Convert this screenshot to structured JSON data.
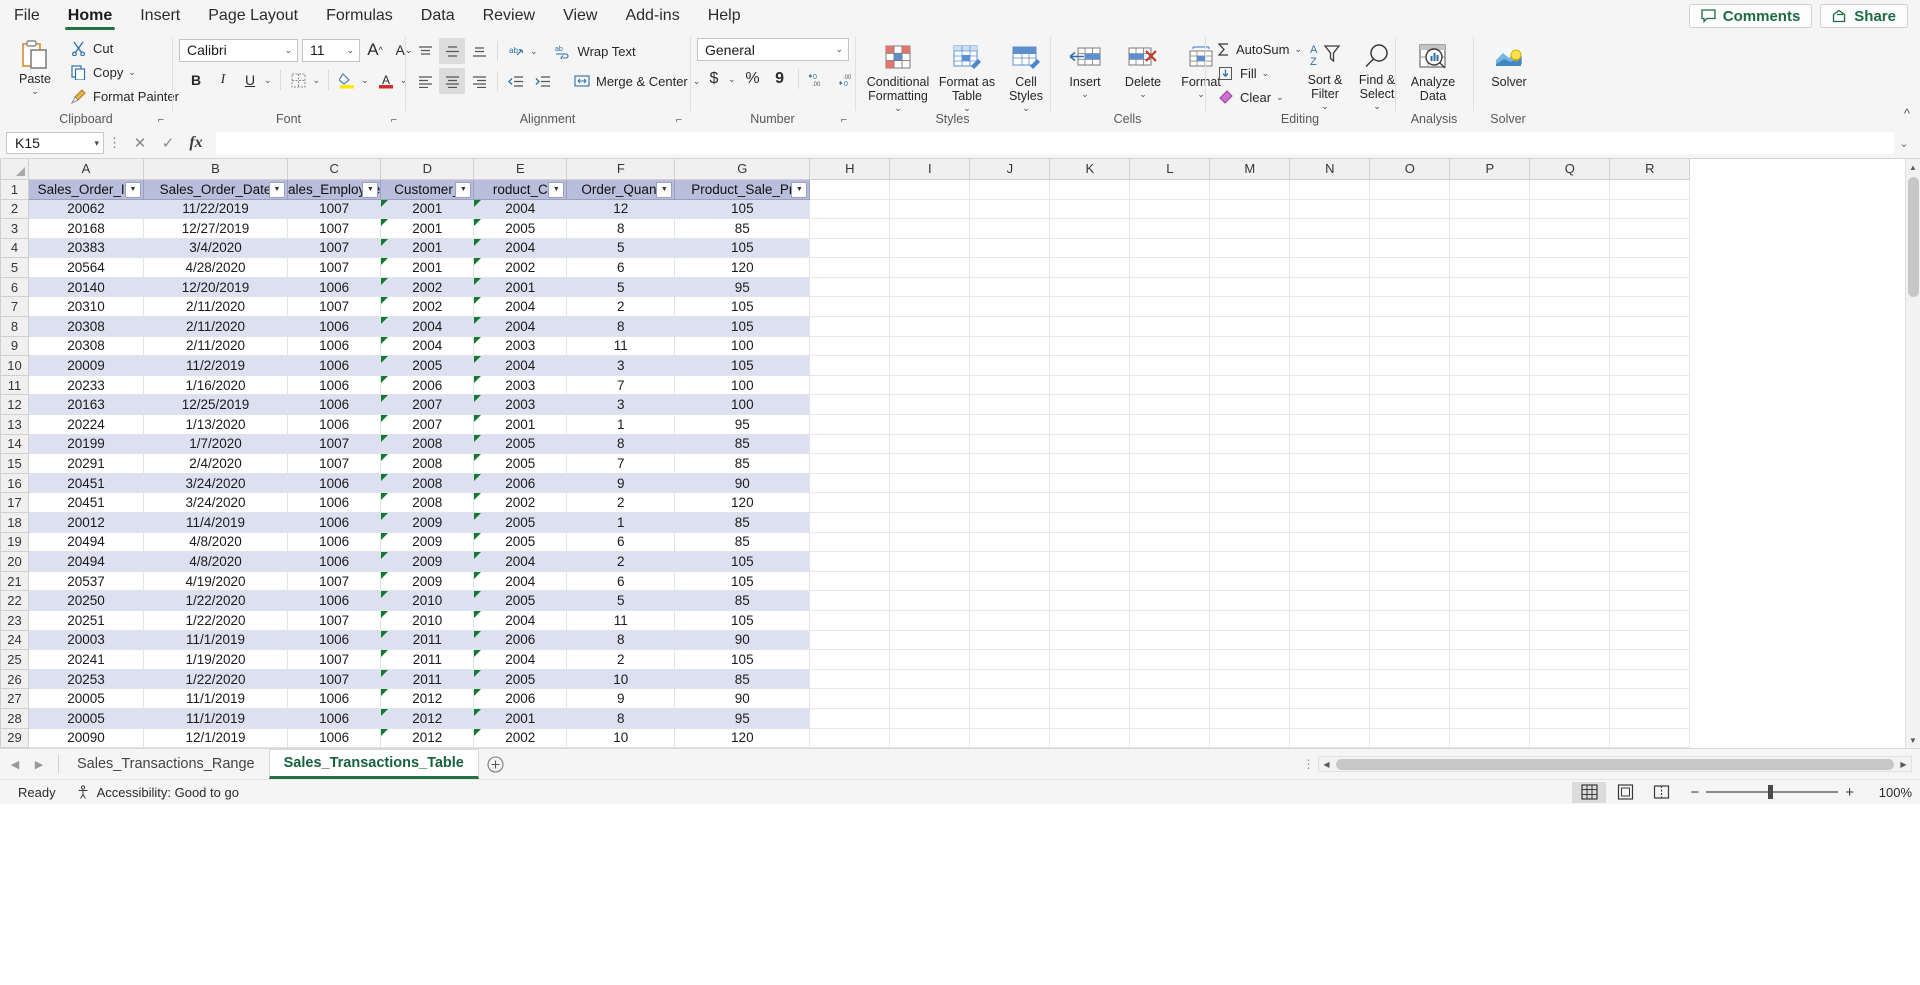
{
  "window": {
    "comments_label": "Comments",
    "share_label": "Share"
  },
  "ribbon": {
    "tabs": [
      {
        "label": "File",
        "active": false
      },
      {
        "label": "Home",
        "active": true
      },
      {
        "label": "Insert",
        "active": false
      },
      {
        "label": "Page Layout",
        "active": false
      },
      {
        "label": "Formulas",
        "active": false
      },
      {
        "label": "Data",
        "active": false
      },
      {
        "label": "Review",
        "active": false
      },
      {
        "label": "View",
        "active": false
      },
      {
        "label": "Add-ins",
        "active": false
      },
      {
        "label": "Help",
        "active": false
      }
    ],
    "groups": {
      "clipboard": {
        "label": "Clipboard",
        "paste": "Paste",
        "cut": "Cut",
        "copy": "Copy",
        "format_painter": "Format Painter"
      },
      "font": {
        "label": "Font",
        "font_name": "Calibri",
        "font_size": "11",
        "grow_font": "A",
        "shrink_font": "A",
        "bold": "B",
        "italic": "I",
        "underline": "U"
      },
      "alignment": {
        "label": "Alignment",
        "wrap_text": "Wrap Text",
        "merge_center": "Merge & Center"
      },
      "number": {
        "label": "Number",
        "format": "General",
        "currency": "$",
        "percent": "%",
        "comma": "9"
      },
      "styles": {
        "label": "Styles",
        "conditional_formatting": "Conditional Formatting",
        "format_as_table": "Format as Table",
        "cell_styles": "Cell Styles"
      },
      "cells": {
        "label": "Cells",
        "insert": "Insert",
        "delete": "Delete",
        "format": "Format"
      },
      "editing": {
        "label": "Editing",
        "autosum": "AutoSum",
        "fill": "Fill",
        "clear": "Clear",
        "sort_filter": "Sort & Filter",
        "find_select": "Find & Select"
      },
      "analysis": {
        "label": "Analysis",
        "analyze_data": "Analyze Data"
      },
      "solver": {
        "label": "Solver",
        "solver": "Solver"
      }
    }
  },
  "formula_bar": {
    "name_box": "K15",
    "formula": "",
    "cancel_icon": "x-icon",
    "confirm_icon": "check-icon",
    "function_icon": "fx"
  },
  "grid": {
    "column_letters": [
      "A",
      "B",
      "C",
      "D",
      "E",
      "F",
      "G",
      "H",
      "I",
      "J",
      "K",
      "L",
      "M",
      "N",
      "O",
      "P",
      "Q",
      "R"
    ],
    "table_headers": [
      "Sales_Order_ID",
      "Sales_Order_Date",
      "ales_Employee",
      "Customer_",
      "roduct_C",
      "Order_Quant",
      "Product_Sale_Pr"
    ],
    "rows": [
      {
        "num": "1",
        "type": "header"
      },
      {
        "num": "2",
        "cells": [
          "20062",
          "11/22/2019",
          "1007",
          "2001",
          "2004",
          "12",
          "105"
        ]
      },
      {
        "num": "3",
        "cells": [
          "20168",
          "12/27/2019",
          "1007",
          "2001",
          "2005",
          "8",
          "85"
        ]
      },
      {
        "num": "4",
        "cells": [
          "20383",
          "3/4/2020",
          "1007",
          "2001",
          "2004",
          "5",
          "105"
        ]
      },
      {
        "num": "5",
        "cells": [
          "20564",
          "4/28/2020",
          "1007",
          "2001",
          "2002",
          "6",
          "120"
        ]
      },
      {
        "num": "6",
        "cells": [
          "20140",
          "12/20/2019",
          "1006",
          "2002",
          "2001",
          "5",
          "95"
        ]
      },
      {
        "num": "7",
        "cells": [
          "20310",
          "2/11/2020",
          "1007",
          "2002",
          "2004",
          "2",
          "105"
        ]
      },
      {
        "num": "8",
        "cells": [
          "20308",
          "2/11/2020",
          "1006",
          "2004",
          "2004",
          "8",
          "105"
        ]
      },
      {
        "num": "9",
        "cells": [
          "20308",
          "2/11/2020",
          "1006",
          "2004",
          "2003",
          "11",
          "100"
        ]
      },
      {
        "num": "10",
        "cells": [
          "20009",
          "11/2/2019",
          "1006",
          "2005",
          "2004",
          "3",
          "105"
        ]
      },
      {
        "num": "11",
        "cells": [
          "20233",
          "1/16/2020",
          "1006",
          "2006",
          "2003",
          "7",
          "100"
        ]
      },
      {
        "num": "12",
        "cells": [
          "20163",
          "12/25/2019",
          "1006",
          "2007",
          "2003",
          "3",
          "100"
        ]
      },
      {
        "num": "13",
        "cells": [
          "20224",
          "1/13/2020",
          "1006",
          "2007",
          "2001",
          "1",
          "95"
        ]
      },
      {
        "num": "14",
        "cells": [
          "20199",
          "1/7/2020",
          "1007",
          "2008",
          "2005",
          "8",
          "85"
        ]
      },
      {
        "num": "15",
        "cells": [
          "20291",
          "2/4/2020",
          "1007",
          "2008",
          "2005",
          "7",
          "85"
        ]
      },
      {
        "num": "16",
        "cells": [
          "20451",
          "3/24/2020",
          "1006",
          "2008",
          "2006",
          "9",
          "90"
        ]
      },
      {
        "num": "17",
        "cells": [
          "20451",
          "3/24/2020",
          "1006",
          "2008",
          "2002",
          "2",
          "120"
        ]
      },
      {
        "num": "18",
        "cells": [
          "20012",
          "11/4/2019",
          "1006",
          "2009",
          "2005",
          "1",
          "85"
        ]
      },
      {
        "num": "19",
        "cells": [
          "20494",
          "4/8/2020",
          "1006",
          "2009",
          "2005",
          "6",
          "85"
        ]
      },
      {
        "num": "20",
        "cells": [
          "20494",
          "4/8/2020",
          "1006",
          "2009",
          "2004",
          "2",
          "105"
        ]
      },
      {
        "num": "21",
        "cells": [
          "20537",
          "4/19/2020",
          "1007",
          "2009",
          "2004",
          "6",
          "105"
        ]
      },
      {
        "num": "22",
        "cells": [
          "20250",
          "1/22/2020",
          "1006",
          "2010",
          "2005",
          "5",
          "85"
        ]
      },
      {
        "num": "23",
        "cells": [
          "20251",
          "1/22/2020",
          "1007",
          "2010",
          "2004",
          "11",
          "105"
        ]
      },
      {
        "num": "24",
        "cells": [
          "20003",
          "11/1/2019",
          "1006",
          "2011",
          "2006",
          "8",
          "90"
        ]
      },
      {
        "num": "25",
        "cells": [
          "20241",
          "1/19/2020",
          "1007",
          "2011",
          "2004",
          "2",
          "105"
        ]
      },
      {
        "num": "26",
        "cells": [
          "20253",
          "1/22/2020",
          "1007",
          "2011",
          "2005",
          "10",
          "85"
        ]
      },
      {
        "num": "27",
        "cells": [
          "20005",
          "11/1/2019",
          "1006",
          "2012",
          "2006",
          "9",
          "90"
        ]
      },
      {
        "num": "28",
        "cells": [
          "20005",
          "11/1/2019",
          "1006",
          "2012",
          "2001",
          "8",
          "95"
        ]
      },
      {
        "num": "29",
        "cells": [
          "20090",
          "12/1/2019",
          "1006",
          "2012",
          "2002",
          "10",
          "120"
        ]
      }
    ]
  },
  "sheet_tabs": {
    "tabs": [
      {
        "label": "Sales_Transactions_Range",
        "active": false
      },
      {
        "label": "Sales_Transactions_Table",
        "active": true
      }
    ],
    "add_sheet_icon": "plus-circle-icon"
  },
  "status_bar": {
    "mode": "Ready",
    "accessibility": "Accessibility: Good to go",
    "zoom": "100%",
    "views": [
      "normal-view-icon",
      "page-layout-icon",
      "page-break-icon"
    ]
  },
  "colors": {
    "accent_green": "#217346",
    "table_header_bg": "#b8bedb",
    "band_bg": "#dce0f0",
    "error_triangle": "#117a2e"
  }
}
